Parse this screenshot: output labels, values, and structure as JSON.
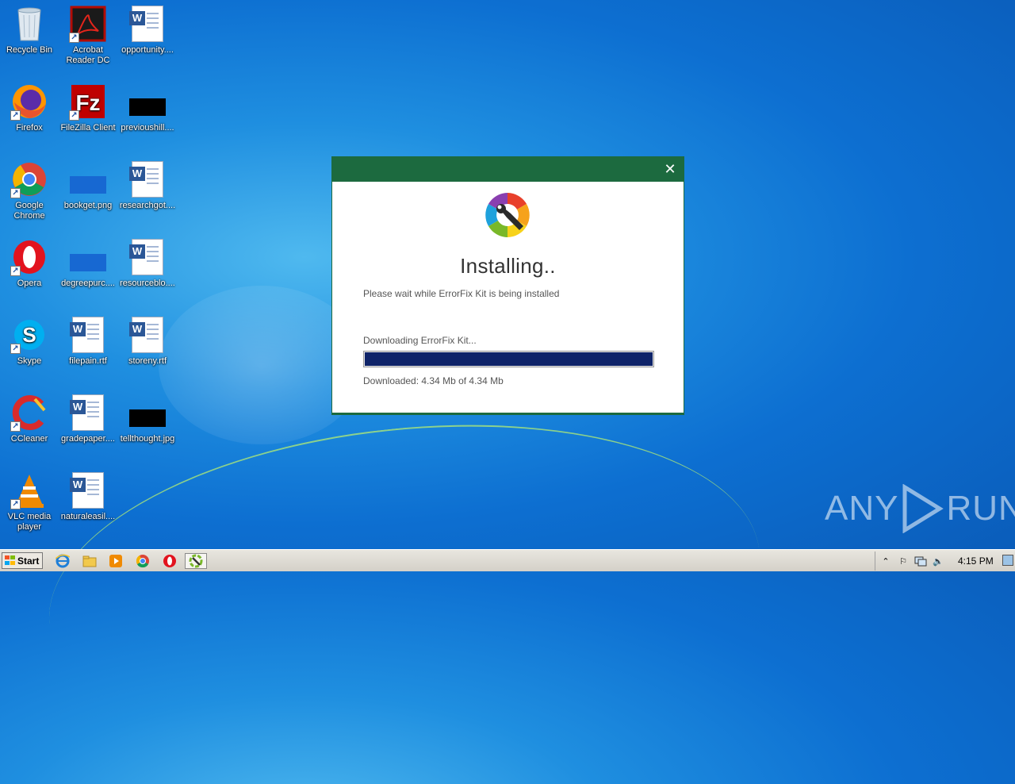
{
  "desktop": {
    "icons": [
      {
        "label": "Recycle Bin",
        "icon": "recycle-bin-icon"
      },
      {
        "label": "Acrobat Reader DC",
        "icon": "acrobat-icon"
      },
      {
        "label": "opportunity....",
        "icon": "word-doc-icon"
      },
      {
        "label": "Firefox",
        "icon": "firefox-icon"
      },
      {
        "label": "FileZilla Client",
        "icon": "filezilla-icon"
      },
      {
        "label": "previoushill....",
        "icon": "image-thumbnail-icon"
      },
      {
        "label": "Google Chrome",
        "icon": "chrome-icon"
      },
      {
        "label": "bookget.png",
        "icon": "image-thumbnail-icon"
      },
      {
        "label": "researchgot....",
        "icon": "word-doc-icon"
      },
      {
        "label": "Opera",
        "icon": "opera-icon"
      },
      {
        "label": "degreepurc....",
        "icon": "image-thumbnail-icon"
      },
      {
        "label": "resourceblo....",
        "icon": "word-doc-icon"
      },
      {
        "label": "Skype",
        "icon": "skype-icon"
      },
      {
        "label": "filepain.rtf",
        "icon": "word-doc-icon"
      },
      {
        "label": "storeny.rtf",
        "icon": "word-doc-icon"
      },
      {
        "label": "CCleaner",
        "icon": "ccleaner-icon"
      },
      {
        "label": "gradepaper....",
        "icon": "word-doc-icon"
      },
      {
        "label": "tellthought.jpg",
        "icon": "image-thumbnail-icon"
      },
      {
        "label": "VLC media player",
        "icon": "vlc-icon"
      },
      {
        "label": "naturaleasil....",
        "icon": "word-doc-icon"
      }
    ]
  },
  "dialog": {
    "close_label": "✕",
    "heading": "Installing..",
    "subtitle": "Please wait while ErrorFix Kit is being installed",
    "status": "Downloading ErrorFix Kit...",
    "progress": 1.0,
    "downloaded_text": "Downloaded: 4.34 Mb of 4.34 Mb",
    "title_color": "#1c6a3f",
    "progress_color": "#0f2469"
  },
  "watermark": {
    "text_left": "ANY",
    "text_right": "RUN"
  },
  "taskbar": {
    "start_label": "Start",
    "pinned": [
      "ie-icon",
      "explorer-icon",
      "media-player-icon",
      "chrome-icon",
      "opera-icon",
      "errorfix-installer-icon"
    ],
    "clock": "4:15 PM"
  }
}
